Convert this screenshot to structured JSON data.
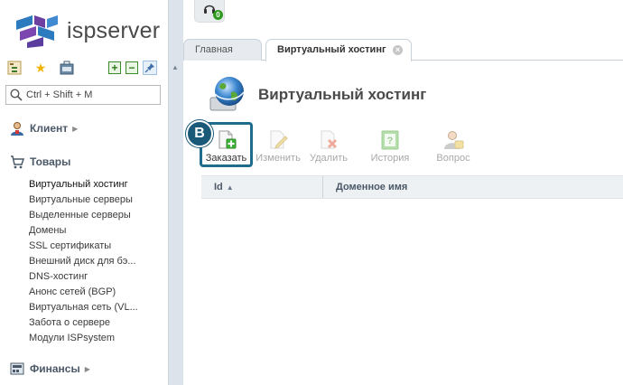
{
  "app": {
    "logo_text": "ispserver"
  },
  "sidebar": {
    "search": {
      "placeholder": "Ctrl + Shift + M"
    },
    "toolbar_icons": [
      "tree-icon",
      "star-icon",
      "briefcase-icon",
      "expand-icon",
      "collapse-icon",
      "pin-icon"
    ],
    "sections": {
      "client": {
        "label": "Клиент"
      },
      "goods": {
        "label": "Товары",
        "items": [
          "Виртуальный хостинг",
          "Виртуальные серверы",
          "Выделенные серверы",
          "Домены",
          "SSL сертификаты",
          "Внешний диск для бэ...",
          "DNS-хостинг",
          "Анонс сетей (BGP)",
          "Виртуальная сеть (VL...",
          "Забота о сервере",
          "Модули ISPsystem"
        ]
      },
      "finance": {
        "label": "Финансы"
      }
    }
  },
  "notifications": {
    "count": "0"
  },
  "tabs": [
    {
      "label": "Главная"
    },
    {
      "label": "Виртуальный хостинг"
    }
  ],
  "page": {
    "title": "Виртуальный хостинг"
  },
  "toolbar": {
    "order": "Заказать",
    "edit": "Изменить",
    "delete": "Удалить",
    "history": "История",
    "question": "Вопрос"
  },
  "annotation": {
    "marker": "B"
  },
  "grid": {
    "columns": [
      {
        "label": "Id"
      },
      {
        "label": "Доменное имя"
      }
    ]
  },
  "colors": {
    "accent": "#1f6c8c",
    "marker": "#1a5a78",
    "ok_green": "#2f9a1e"
  }
}
